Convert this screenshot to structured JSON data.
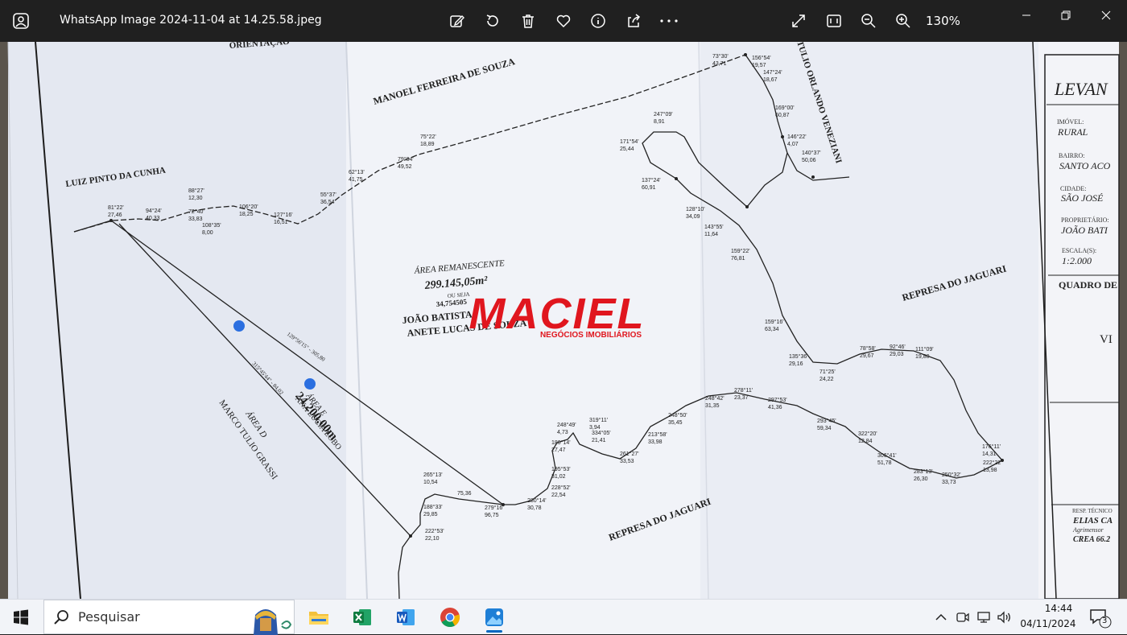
{
  "window": {
    "title": "WhatsApp Image 2024-11-04 at 14.25.58.jpeg",
    "zoom_label": "130%",
    "toolbar_icons": [
      "edit-icon",
      "rotate-icon",
      "delete-icon",
      "favorite-icon",
      "info-icon",
      "share-icon",
      "more-icon"
    ],
    "view_icons": [
      "fullscreen-icon",
      "fit-icon",
      "zoom-out-icon",
      "zoom-in-icon"
    ]
  },
  "map": {
    "orientation": "ORIENTAÇÃO",
    "neighbor_top": "MANOEL FERREIRA DE SOUZA",
    "neighbor_left": "LUIZ PINTO DA CUNHA",
    "neighbor_right": "TULIO ORLANDO VENEZIANI",
    "area_title": "ÁREA REMANESCENTE",
    "area_value": "299.145,05m²",
    "area_ou": "OU SEJA",
    "area_alqueires": "34,754505",
    "owners_1": "JOÃO BATISTA",
    "owners_2": "ANETE LUCAS DE SOUZA",
    "represa_1": "REPRESA DO JAGUARI",
    "represa_2": "REPRESA DO JAGUARI",
    "area_e_label": "ÁREA E",
    "area_e_value": "24.200,00m",
    "area_e_owner": "ANA LUCIA LOBO",
    "area_d_label": "ÁREA D",
    "area_d_owner": "MARCO TULIO GRASSI",
    "diag_1": "129°56'15\" - 305,80",
    "diag_2": "315°45'44\" - 84,02",
    "distances": [
      {
        "a": "81°22'",
        "b": "27,46"
      },
      {
        "a": "94°24'",
        "b": "40,33"
      },
      {
        "a": "88°27'",
        "b": "12,30"
      },
      {
        "a": "72°40'",
        "b": "33,83"
      },
      {
        "a": "108°35'",
        "b": "8,00"
      },
      {
        "a": "106°20'",
        "b": "18,25"
      },
      {
        "a": "127°16'",
        "b": "16,51"
      },
      {
        "a": "55°37'",
        "b": "36,54"
      },
      {
        "a": "62°13'",
        "b": "41,75"
      },
      {
        "a": "79°04'",
        "b": "49,52"
      },
      {
        "a": "75°22'",
        "b": "18,89"
      },
      {
        "a": "73°30'",
        "b": "43,71"
      },
      {
        "a": "156°54'",
        "b": "19,57"
      },
      {
        "a": "147°24'",
        "b": "18,67"
      },
      {
        "a": "169°00'",
        "b": "60,87"
      },
      {
        "a": "146°22'",
        "b": "4,07"
      },
      {
        "a": "140°37'",
        "b": "50,06"
      },
      {
        "a": "247°09'",
        "b": "8,91"
      },
      {
        "a": "171°54'",
        "b": "25,44"
      },
      {
        "a": "137°24'",
        "b": "60,91"
      },
      {
        "a": "128°10'",
        "b": "34,09"
      },
      {
        "a": "143°55'",
        "b": "11,64"
      },
      {
        "a": "159°22'",
        "b": "76,81"
      },
      {
        "a": "159°16'",
        "b": "63,34"
      },
      {
        "a": "135°36'",
        "b": "29,16"
      },
      {
        "a": "71°25'",
        "b": "24,22"
      },
      {
        "a": "78°58'",
        "b": "29,67"
      },
      {
        "a": "92°46'",
        "b": "29,03"
      },
      {
        "a": "111°09'",
        "b": "19,80"
      },
      {
        "a": "176°11'",
        "b": "14,31"
      },
      {
        "a": "222°22'",
        "b": "13,98"
      },
      {
        "a": "250°32'",
        "b": "33,73"
      },
      {
        "a": "283°13'",
        "b": "26,30"
      },
      {
        "a": "306°41'",
        "b": "51,78"
      },
      {
        "a": "322°20'",
        "b": "12,84"
      },
      {
        "a": "293°45'",
        "b": "59,34"
      },
      {
        "a": "297°53'",
        "b": "41,36"
      },
      {
        "a": "278°11'",
        "b": "23,37"
      },
      {
        "a": "248°42'",
        "b": "31,35"
      },
      {
        "a": "248°50'",
        "b": "35,45"
      },
      {
        "a": "213°58'",
        "b": "33,98"
      },
      {
        "a": "261°27'",
        "b": "33,53"
      },
      {
        "a": "334°05'",
        "b": "21,41"
      },
      {
        "a": "319°11'",
        "b": "3,94"
      },
      {
        "a": "248°49'",
        "b": "4,73"
      },
      {
        "a": "180°14'",
        "b": "27,47"
      },
      {
        "a": "195°53'",
        "b": "31,02"
      },
      {
        "a": "228°52'",
        "b": "22,54"
      },
      {
        "a": "280°14'",
        "b": "30,78"
      },
      {
        "a": "279°16'",
        "b": "96,75"
      },
      {
        "a": "75,36",
        "b": ""
      },
      {
        "a": "265°13'",
        "b": "10,54"
      },
      {
        "a": "188°33'",
        "b": "29,85"
      },
      {
        "a": "222°53'",
        "b": "22,10"
      }
    ],
    "title_block": {
      "heading": "LEVAN",
      "imovel_label": "IMÓVEL:",
      "imovel": "RURAL",
      "bairro_label": "BAIRRO:",
      "bairro": "SANTO ACO",
      "cidade_label": "CIDADE:",
      "cidade": "SÃO JOSÉ",
      "proprietario_label": "PROPRIETÁRIO:",
      "proprietario": "JOÃO BATI",
      "escala_label": "ESCALA(S):",
      "escala": "1:2.000",
      "quadro": "QUADRO DE",
      "vi": "VI",
      "resp_label": "RESP. TÉCNICO",
      "resp": "ELIAS CA",
      "resp_2": "Agrimensor",
      "crea": "CREA 66.2"
    }
  },
  "watermark": {
    "brand": "MACIEL",
    "tagline": "NEGÓCIOS IMOBILIÁRIOS",
    "color": "#e0161e"
  },
  "taskbar": {
    "search_placeholder": "Pesquisar",
    "apps": [
      "file-explorer-icon",
      "excel-icon",
      "word-icon",
      "chrome-icon",
      "photos-icon"
    ],
    "time": "14:44",
    "date": "04/11/2024",
    "notification_count": "3"
  }
}
